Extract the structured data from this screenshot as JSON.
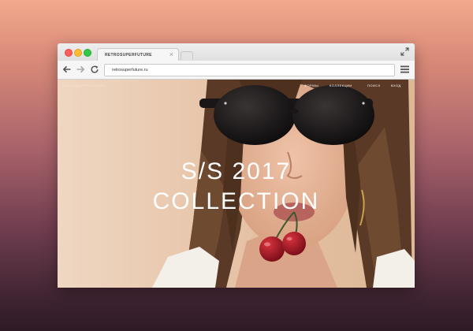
{
  "browser": {
    "tab_title": "RETROSUPERFUTURE",
    "tab_close": "×",
    "address": "retrosuperfuture.ru"
  },
  "site": {
    "logo": "RETROSUPERFUTURE",
    "nav": [
      "ФОРМЫ",
      "КОЛЛЕКЦИИ",
      "ПОИСК",
      "ВХОД"
    ]
  },
  "hero": {
    "line1": "S/S 2017",
    "line2": "COLLECTION"
  },
  "colors": {
    "background_top": "#f2a98d",
    "background_bottom": "#2e1a25",
    "close_light": "#fc5f57",
    "minimize_light": "#fdbc2e",
    "zoom_light": "#33c748"
  },
  "icons": [
    "close-light",
    "minimize-light",
    "zoom-light",
    "fullscreen-icon",
    "back-arrow-icon",
    "forward-arrow-icon",
    "reload-icon",
    "menu-icon"
  ]
}
